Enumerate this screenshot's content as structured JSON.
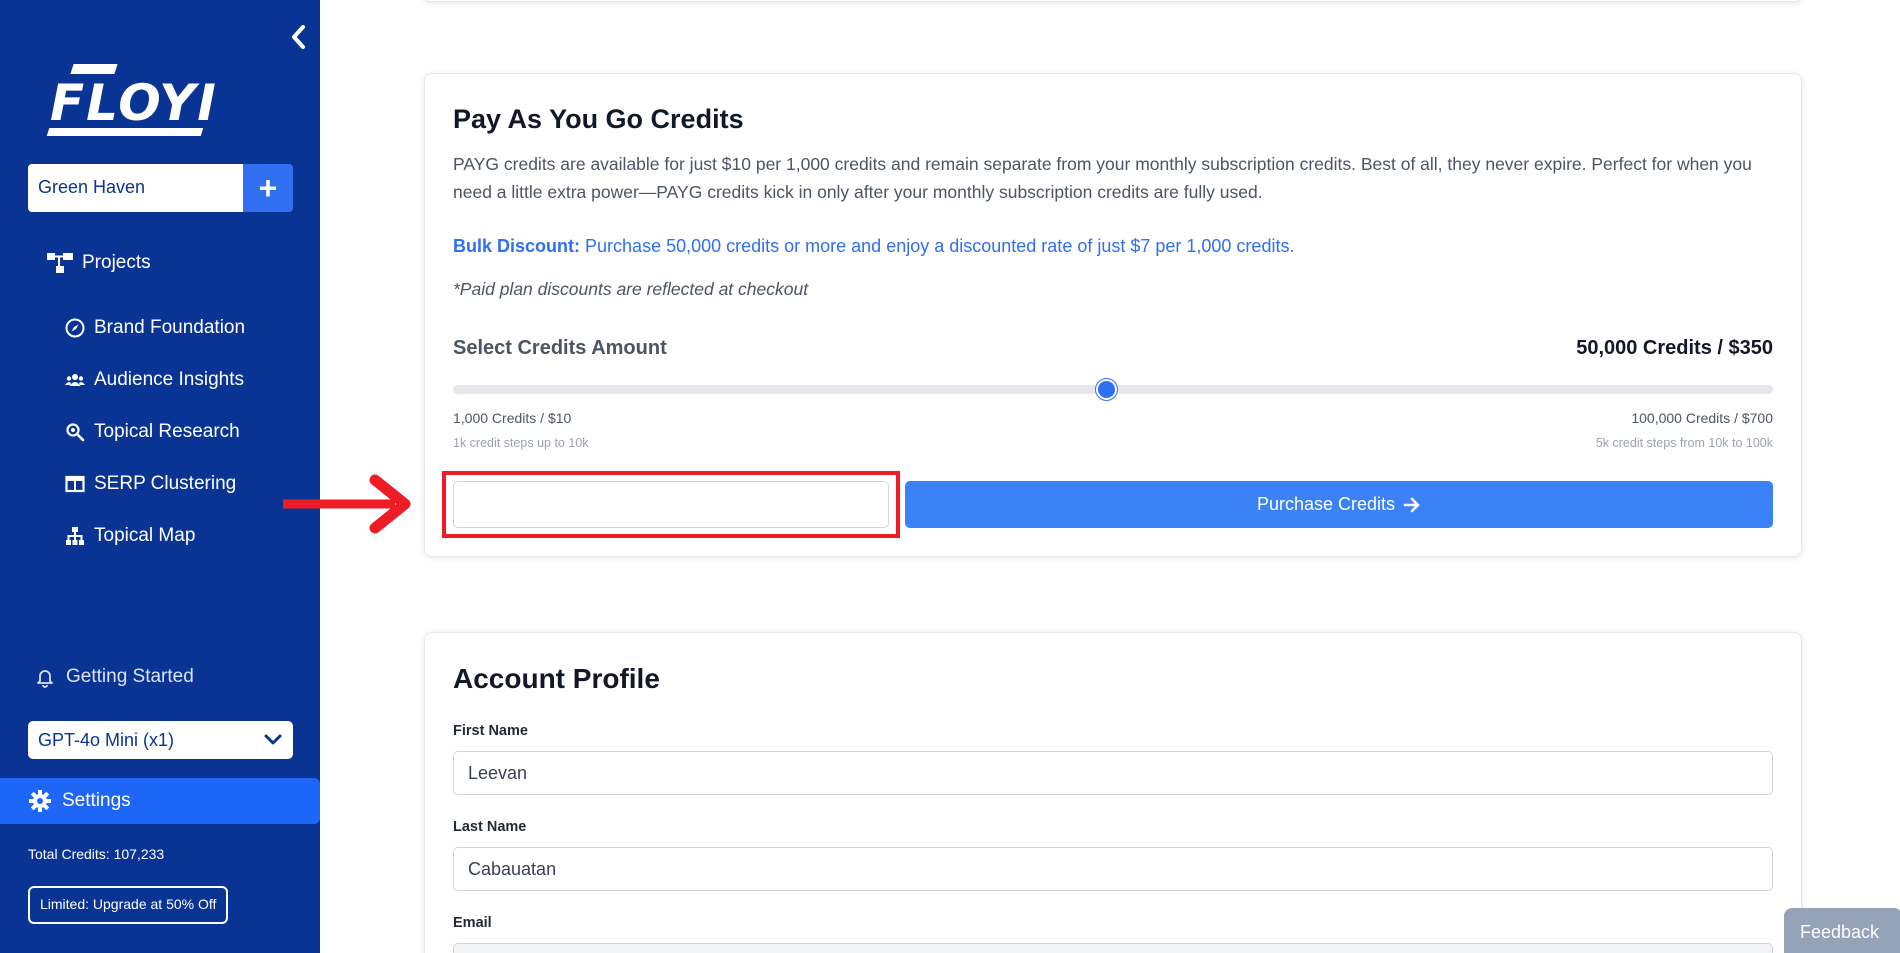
{
  "sidebar": {
    "logo_text": "FLOYI",
    "workspace": {
      "name": "Green Haven",
      "add_symbol": "+"
    },
    "projects_label": "Projects",
    "items": [
      {
        "label": "Brand Foundation",
        "icon": "compass-icon"
      },
      {
        "label": "Audience Insights",
        "icon": "users-icon"
      },
      {
        "label": "Topical Research",
        "icon": "search-icon"
      },
      {
        "label": "SERP Clustering",
        "icon": "columns-icon"
      },
      {
        "label": "Topical Map",
        "icon": "sitemap-icon"
      }
    ],
    "getting_started": "Getting Started",
    "model": "GPT-4o Mini (x1)",
    "settings": "Settings",
    "total_credits": "Total Credits: 107,233",
    "upgrade": "Limited: Upgrade at 50% Off"
  },
  "payg": {
    "title": "Pay As You Go Credits",
    "description": "PAYG credits are available for just $10 per 1,000 credits and remain separate from your monthly subscription credits. Best of all, they never expire. Perfect for when you need a little extra power—PAYG credits kick in only after your monthly subscription credits are fully used.",
    "bulk_label": "Bulk Discount:",
    "bulk_text": "Purchase 50,000 credits or more and enjoy a discounted rate of just $7 per 1,000 credits.",
    "paid_note": "*Paid plan discounts are reflected at checkout",
    "select_label": "Select Credits Amount",
    "selected_value": "50,000 Credits / $350",
    "slider_fraction": 0.495,
    "min_label": "1,000 Credits / $10",
    "min_note": "1k credit steps up to 10k",
    "max_label": "100,000 Credits / $700",
    "max_note": "5k credit steps from 10k to 100k",
    "input_value": "",
    "purchase_label": "Purchase Credits"
  },
  "profile": {
    "title": "Account Profile",
    "first_name_label": "First Name",
    "first_name": "Leevan",
    "last_name_label": "Last Name",
    "last_name": "Cabauatan",
    "email_label": "Email"
  },
  "feedback": "Feedback",
  "colors": {
    "sidebar_bg": "#0a3494",
    "accent": "#2f6ff0",
    "button": "#3b82f6",
    "highlight": "#ee1c24"
  }
}
